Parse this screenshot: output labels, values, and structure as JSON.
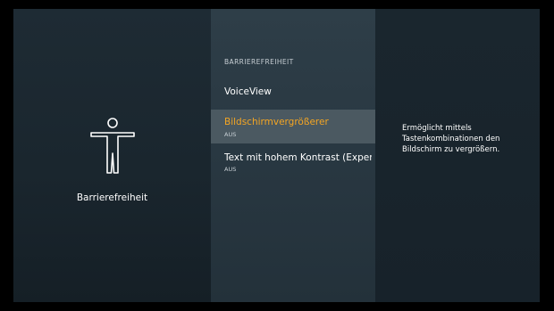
{
  "left": {
    "title": "Barrierefreiheit",
    "icon": "accessibility-person-icon"
  },
  "menu": {
    "header": "BARRIEREFREIHEIT",
    "items": [
      {
        "title": "VoiceView",
        "subtitle": ""
      },
      {
        "title": "Bildschirmvergrößerer",
        "subtitle": "AUS",
        "selected": true
      },
      {
        "title": "Text mit hohem Kontrast (Experimentell)",
        "subtitle": "AUS"
      }
    ]
  },
  "right": {
    "description": "Ermöglicht mittels Tastenkombinationen den Bildschirm zu vergrößern."
  },
  "colors": {
    "accent": "#f5a623",
    "selected_bg": "#4b5961"
  }
}
